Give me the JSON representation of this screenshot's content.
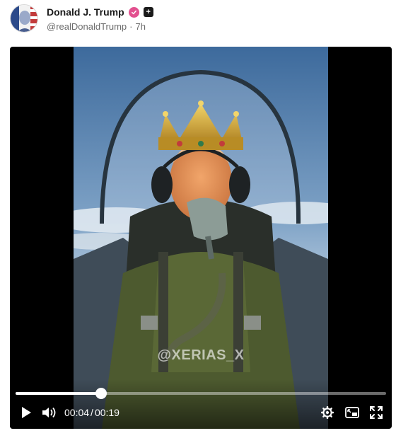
{
  "post": {
    "display_name": "Donald J. Trump",
    "plus_badge": "+",
    "handle": "@realDonaldTrump",
    "separator": "·",
    "time_ago": "7h"
  },
  "video": {
    "watermark": "@XERIAS_X",
    "current_time": "00:04",
    "time_separator": "/",
    "duration": "00:19",
    "progress_fraction": 0.23
  },
  "icons": {
    "play": "play-icon",
    "volume": "volume-icon",
    "settings": "gear-icon",
    "pip": "picture-in-picture-icon",
    "fullscreen": "fullscreen-icon",
    "verified": "verified-badge-icon"
  },
  "colors": {
    "verified_badge": "#e2508f",
    "player_background": "#000000",
    "handle_text": "#6b6b6b"
  }
}
